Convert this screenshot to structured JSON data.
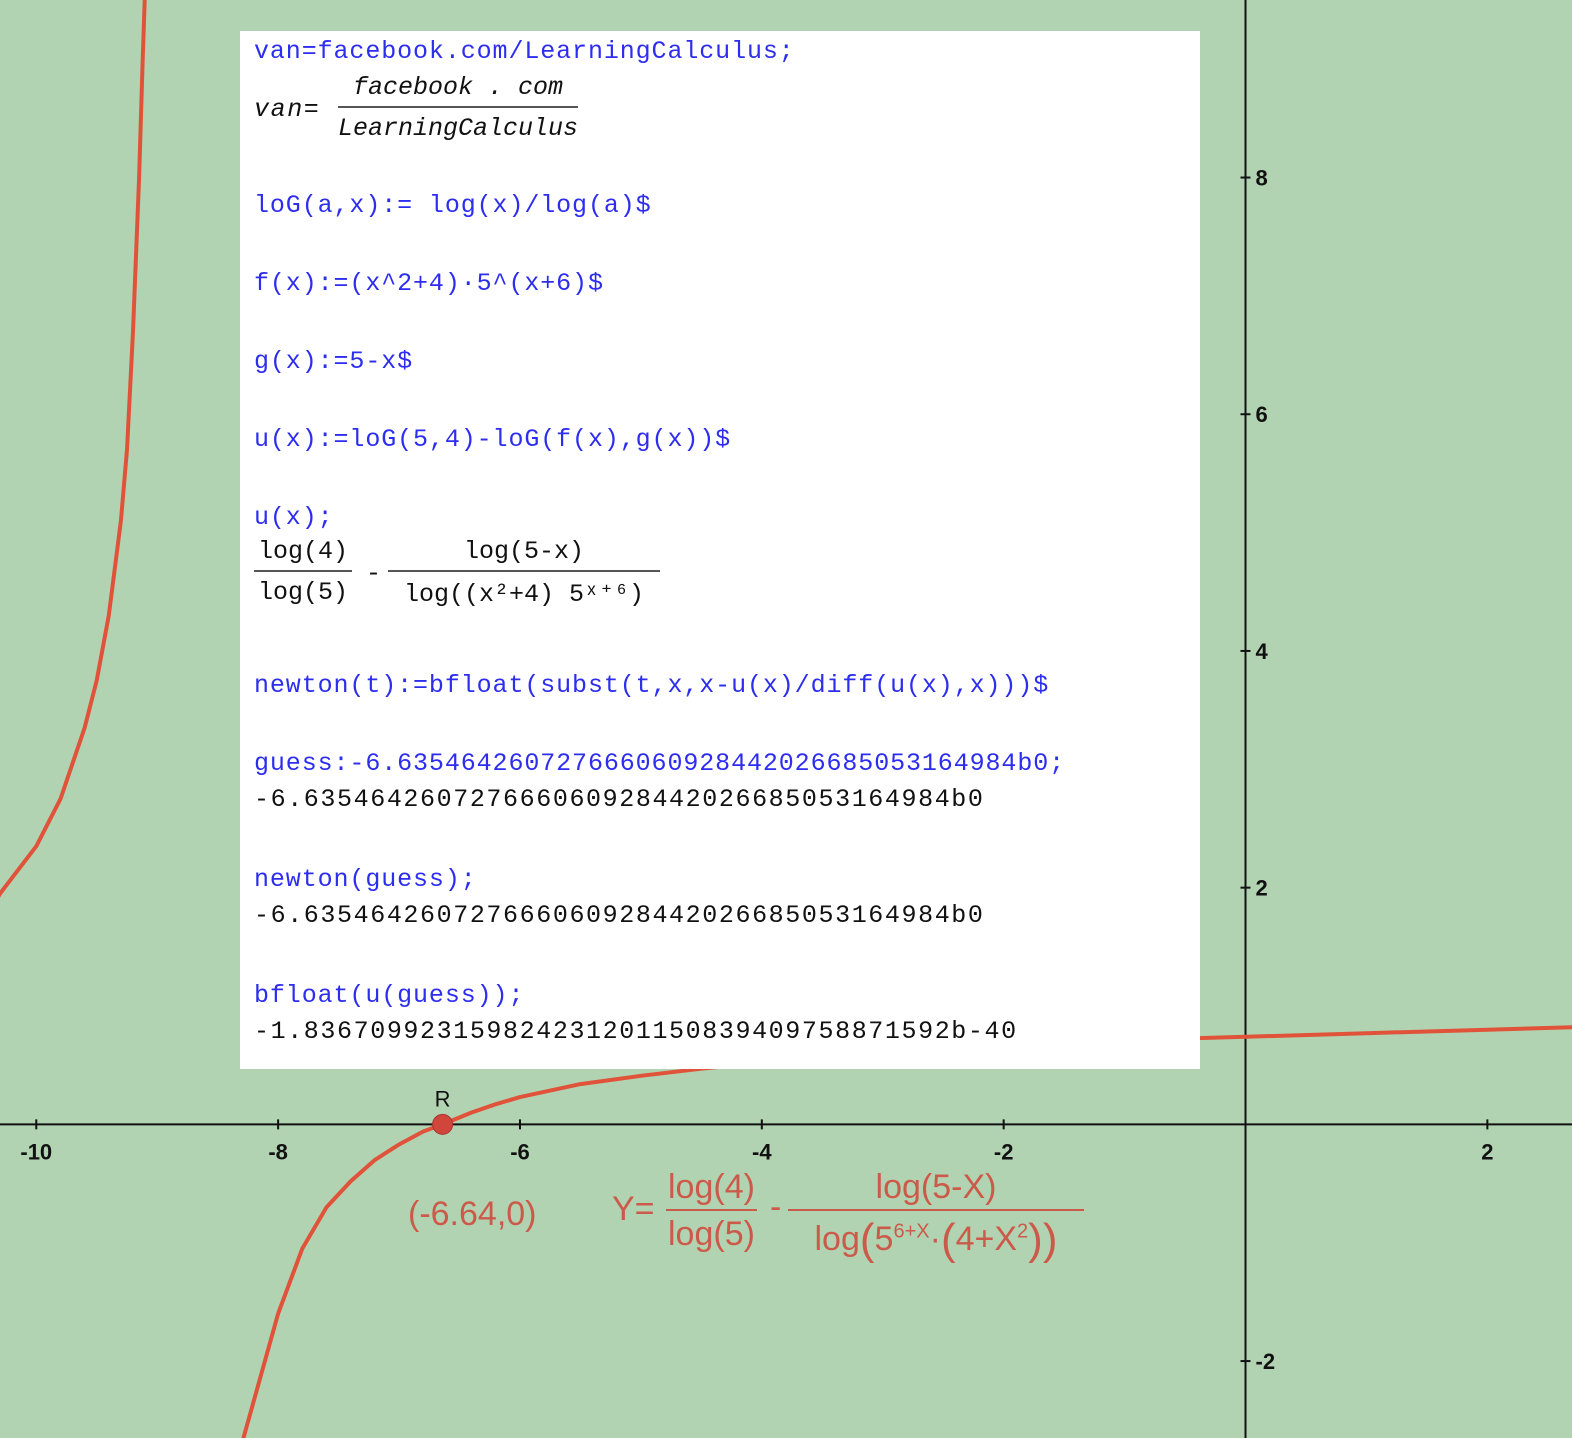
{
  "chart_data": {
    "type": "line",
    "title": "",
    "xlabel": "",
    "ylabel": "",
    "xlim": [
      -10.3,
      2.7
    ],
    "ylim": [
      -2.65,
      9.5
    ],
    "grid": false,
    "x_ticks": [
      -10,
      -8,
      -6,
      -4,
      -2,
      2
    ],
    "y_ticks": [
      -2,
      2,
      4,
      6,
      8
    ],
    "series": [
      {
        "name": "",
        "color": "#e0533a",
        "x": [
          -10.6,
          -10.3,
          -10.0,
          -9.8,
          -9.6,
          -9.5,
          -9.4,
          -9.3,
          -9.25,
          -9.2,
          -9.15,
          -9.12,
          -9.1,
          -9.08,
          -8.3,
          -8.0,
          -7.8,
          -7.6,
          -7.4,
          -7.2,
          -7.0,
          -6.8,
          -6.64,
          -6.4,
          -6.2,
          -6.0,
          -5.5,
          -5.0,
          -4.5,
          -4.0,
          -3.5,
          -3.0,
          -2.5,
          -2.0,
          -1.5,
          -1.0,
          0.0,
          1.0,
          2.0,
          2.7
        ],
        "y": [
          1.4,
          1.95,
          2.35,
          2.75,
          3.35,
          3.75,
          4.3,
          5.1,
          5.7,
          6.7,
          8.0,
          9.0,
          9.6,
          10.2,
          -2.7,
          -1.6,
          -1.05,
          -0.7,
          -0.48,
          -0.3,
          -0.17,
          -0.06,
          0.0,
          0.1,
          0.17,
          0.23,
          0.34,
          0.41,
          0.47,
          0.52,
          0.56,
          0.6,
          0.63,
          0.66,
          0.69,
          0.71,
          0.74,
          0.77,
          0.8,
          0.82
        ]
      }
    ],
    "points": [
      {
        "label": "R",
        "x": -6.64,
        "y": 0
      }
    ]
  },
  "annotations": {
    "coord": "(-6.64,0)",
    "formula": {
      "lhs": "Y=",
      "frac1_num": "log(4)",
      "frac1_den": "log(5)",
      "minus": "-",
      "frac2_num": "log(5-X)",
      "den_log": "log",
      "den_paren_open": "(",
      "den_base": "5",
      "den_exp": "6+X",
      "den_dot": "·",
      "den_inner_open": "(",
      "den_inner": "4+X",
      "den_inner_exp": "2",
      "den_inner_close": ")",
      "den_paren_close": ")"
    }
  },
  "console": {
    "line1": "van=facebook.com/LearningCalculus;",
    "out1_lhs": "van=",
    "out1_num": "facebook . com",
    "out1_den": "LearningCalculus",
    "line2": "loG(a,x):= log(x)/log(a)$",
    "line3": "f(x):=(x^2+4)·5^(x+6)$",
    "line4": "g(x):=5-x$",
    "line5": "u(x):=loG(5,4)-loG(f(x),g(x))$",
    "line6": "u(x);",
    "out6_f1_num": "log(4)",
    "out6_f1_den": "log(5)",
    "out6_minus": "-",
    "out6_f2_num": "log(5-x)",
    "out6_f2_den": "log((x²+4) 5ˣ⁺⁶)",
    "line7": "newton(t):=bfloat(subst(t,x,x-u(x)/diff(u(x),x)))$",
    "line8": "guess:-6.635464260727666060928442026685053164984b0;",
    "out8": "-6.635464260727666060928442026685053164984b0",
    "line9": "newton(guess);",
    "out9": "-6.635464260727666060928442026685053164984b0",
    "line10": "bfloat(u(guess));",
    "out10": "-1.836709923159824231201150839409758871592b-40"
  }
}
